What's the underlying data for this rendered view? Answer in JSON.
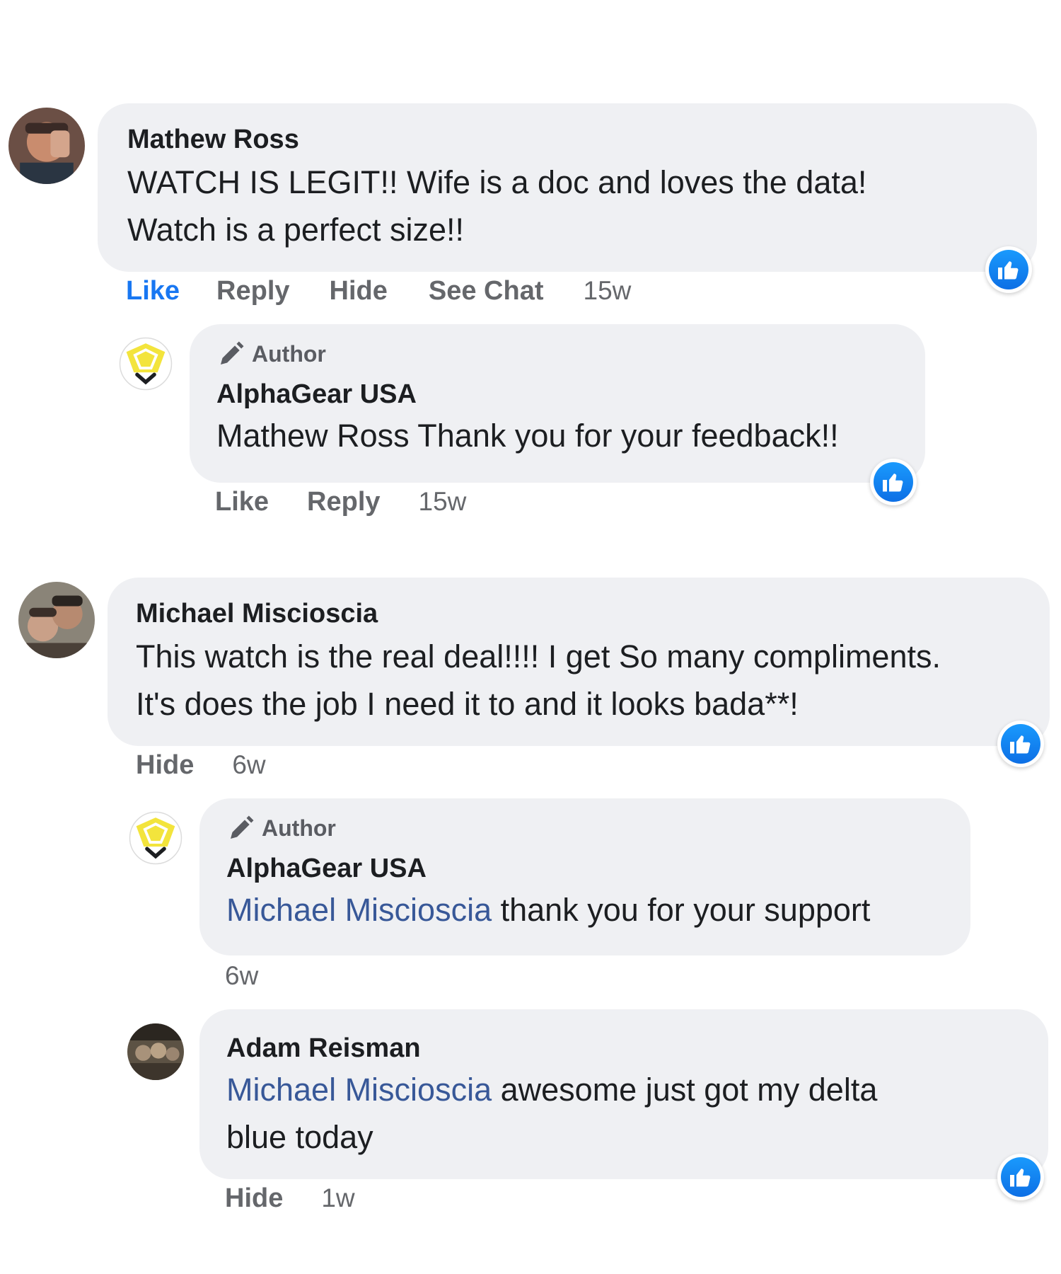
{
  "comments": [
    {
      "author": "Mathew Ross",
      "text_lines": [
        "WATCH IS LEGIT!! Wife is a doc and loves the data!",
        "Watch is a perfect size!!"
      ],
      "actions": {
        "like": "Like",
        "reply": "Reply",
        "hide": "Hide",
        "see_chat": "See Chat"
      },
      "time": "15w",
      "reply": {
        "badge": "Author",
        "author": "AlphaGear USA",
        "mention": "",
        "text": "Mathew Ross Thank you for your feedback!!",
        "actions": {
          "like": "Like",
          "reply": "Reply"
        },
        "time": "15w"
      }
    },
    {
      "author": "Michael Miscioscia",
      "text_lines": [
        "This watch is the real deal!!!! I get So many compliments.",
        "It's does the job I need it to and it looks bada**!"
      ],
      "actions": {
        "hide": "Hide"
      },
      "time": "6w",
      "replies": [
        {
          "badge": "Author",
          "author": "AlphaGear USA",
          "mention": "Michael Miscioscia",
          "text": " thank you for your support",
          "time": "6w"
        },
        {
          "author": "Adam Reisman",
          "mention": "Michael Miscioscia",
          "text_line1": " awesome just got my delta",
          "text_line2": "blue today",
          "actions": {
            "hide": "Hide"
          },
          "time": "1w"
        }
      ]
    }
  ],
  "icons": {
    "reaction": "like-reaction-icon",
    "badge": "pencil-icon",
    "brand_avatar": "alphagear-logo"
  },
  "colors": {
    "bubble": "#eff0f3",
    "like_active": "#1877f2",
    "mention": "#385898",
    "meta": "#65676b",
    "logo": "#f3e43c"
  }
}
